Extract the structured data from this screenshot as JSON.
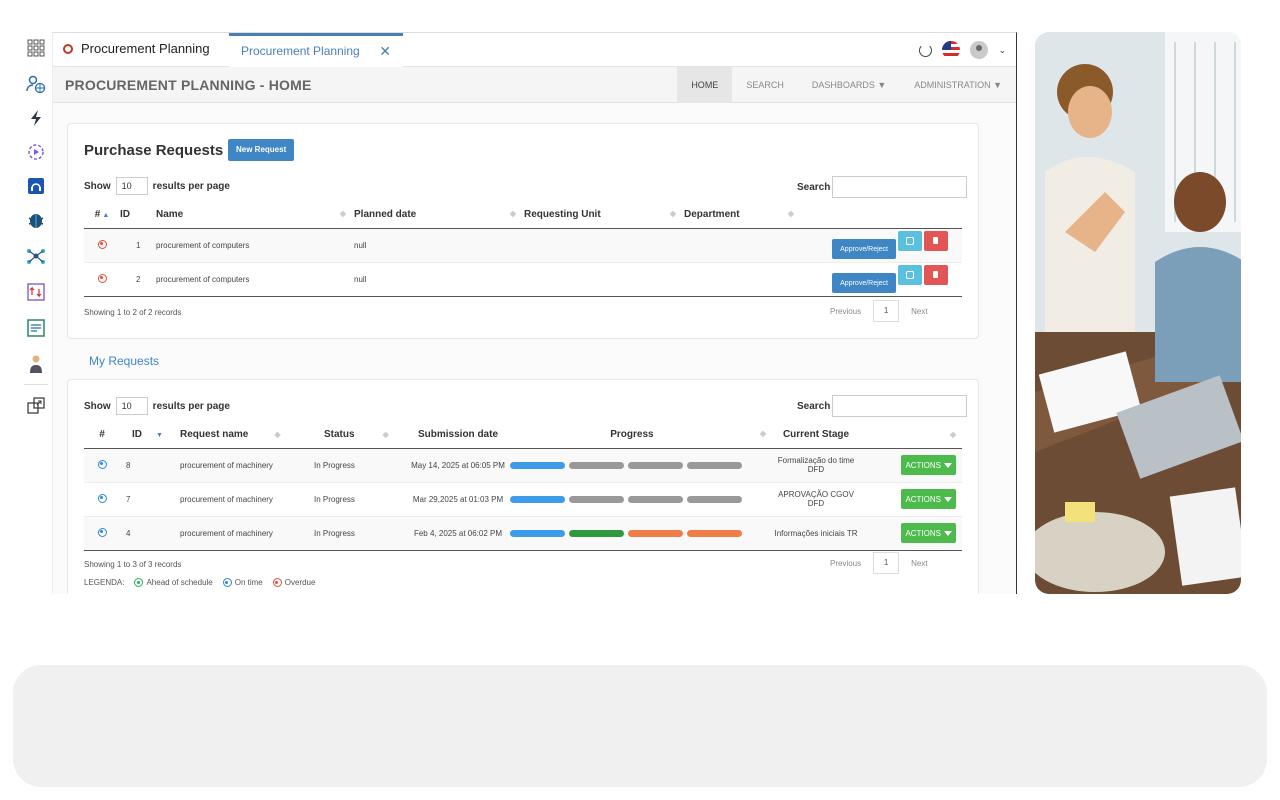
{
  "window": {
    "app_title": "Procurement Planning",
    "active_tab": "Procurement Planning",
    "close_glyph": "✕"
  },
  "header": {
    "page_title": "PROCUREMENT PLANNING - HOME",
    "nav": [
      {
        "label": "HOME",
        "active": true
      },
      {
        "label": "SEARCH",
        "active": false
      },
      {
        "label": "DASHBOARDS ▼",
        "active": false
      },
      {
        "label": "ADMINISTRATION ▼",
        "active": false
      }
    ]
  },
  "purchase_requests": {
    "title": "Purchase Requests",
    "new_button": "New Request",
    "show": "Show",
    "per_page_value": "10",
    "per_page_label": "results per page",
    "search_label": "Search",
    "columns": [
      "#",
      "ID",
      "Name",
      "Planned date",
      "Requesting Unit",
      "Department"
    ],
    "rows": [
      {
        "id": "1",
        "name": "procurement of computers",
        "planned": "null",
        "status": "overdue"
      },
      {
        "id": "2",
        "name": "procurement of computers",
        "planned": "null",
        "status": "overdue"
      }
    ],
    "approve_label": "Approve/Reject",
    "footer": "Showing 1 to 2 of 2 records",
    "prev": "Previous",
    "page": "1",
    "next": "Next"
  },
  "my_requests": {
    "title": "My Requests",
    "show": "Show",
    "per_page_value": "10",
    "per_page_label": "results per page",
    "search_label": "Search",
    "columns": [
      "#",
      "ID",
      "Request name",
      "Status",
      "Submission date",
      "Progress",
      "Current Stage"
    ],
    "rows": [
      {
        "id": "8",
        "name": "procurement of machinery",
        "status": "In Progress",
        "date": "May 14, 2025 at 06:05 PM",
        "stage": "Formalização do time DFD",
        "progress": [
          "#3d9be9",
          "#999999",
          "#999999",
          "#999999"
        ]
      },
      {
        "id": "7",
        "name": "procurement of machinery",
        "status": "In Progress",
        "date": "Mar 29,2025 at 01:03 PM",
        "stage": "APROVAÇÃO CGOV DFD",
        "progress": [
          "#3d9be9",
          "#999999",
          "#999999",
          "#999999"
        ]
      },
      {
        "id": "4",
        "name": "procurement of machinery",
        "status": "In Progress",
        "date": "Feb 4, 2025 at 06:02 PM",
        "stage": "Informações iniciais TR",
        "progress": [
          "#3d9be9",
          "#2e9a3e",
          "#ef7d45",
          "#ef7d45"
        ]
      }
    ],
    "actions_label": "ACTIONS",
    "footer": "Showing 1 to 3 of 3 records",
    "prev": "Previous",
    "page": "1",
    "next": "Next",
    "legend_label": "LEGENDA:",
    "legend": [
      "Ahead of schedule",
      "On time",
      "Overdue"
    ]
  },
  "colors": {
    "primary": "#3e86c4",
    "success": "#4cbb4c",
    "danger": "#e25555",
    "info": "#5bc0de"
  }
}
